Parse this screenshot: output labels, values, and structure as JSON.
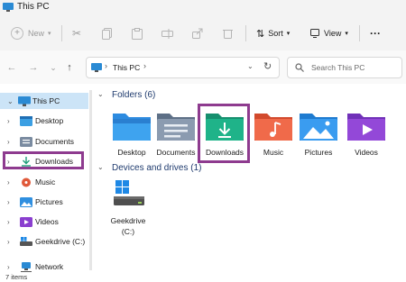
{
  "window": {
    "title": "This PC"
  },
  "toolbar": {
    "new_label": "New",
    "sort_label": "Sort",
    "view_label": "View",
    "more_label": "···"
  },
  "address": {
    "crumb": "This PC",
    "search_placeholder": "Search This PC"
  },
  "sidebar": {
    "items": [
      {
        "label": "This PC",
        "icon": "monitor-icon"
      },
      {
        "label": "Desktop",
        "icon": "desktop-icon"
      },
      {
        "label": "Documents",
        "icon": "documents-icon"
      },
      {
        "label": "Downloads",
        "icon": "download-icon"
      },
      {
        "label": "Music",
        "icon": "music-icon"
      },
      {
        "label": "Pictures",
        "icon": "pictures-icon"
      },
      {
        "label": "Videos",
        "icon": "videos-icon"
      },
      {
        "label": "Geekdrive (C:)",
        "icon": "drive-icon"
      },
      {
        "label": "Network",
        "icon": "network-icon"
      }
    ]
  },
  "folders_section": {
    "title": "Folders (6)"
  },
  "folders": [
    {
      "label": "Desktop"
    },
    {
      "label": "Documents"
    },
    {
      "label": "Downloads"
    },
    {
      "label": "Music"
    },
    {
      "label": "Pictures"
    },
    {
      "label": "Videos"
    }
  ],
  "devices_section": {
    "title": "Devices and drives (1)"
  },
  "drives": [
    {
      "label": "Geekdrive (C:)"
    }
  ],
  "status": {
    "items_count": "7 items"
  },
  "colors": {
    "highlight": "#8e3b8f",
    "accent": "#0067c0"
  }
}
